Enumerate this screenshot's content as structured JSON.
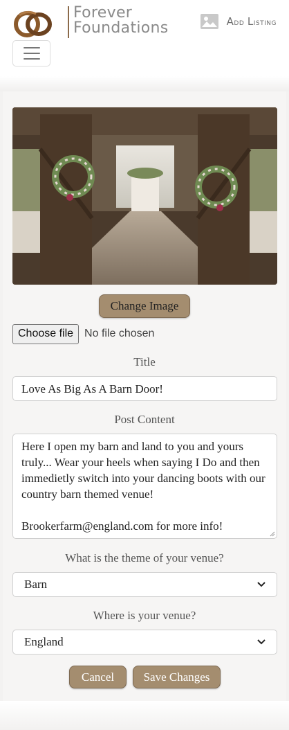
{
  "brand": {
    "line1": "Forever",
    "line2": "Foundations"
  },
  "nav": {
    "add_listing_cap": "A",
    "add_listing_rest": "dd ",
    "add_listing_cap2": "L",
    "add_listing_rest2": "isting",
    "add_listing_icon": "image-icon",
    "menu_icon": "hamburger-menu-icon"
  },
  "form": {
    "change_image_label": "Change Image",
    "file_button_label": "Choose file",
    "file_status": "No file chosen",
    "title_label": "Title",
    "title_value": "Love As Big As A Barn Door!",
    "content_label": "Post Content",
    "content_value": "Here I open my barn and land to you and yours truly... Wear your heels when saying I Do and then immedietly switch into your dancing boots with our country barn themed venue!\n\nBrookerfarm@england.com for more info!",
    "theme_label": "What is the theme of your venue?",
    "theme_value": "Barn",
    "location_label": "Where is your venue?",
    "location_value": "England",
    "cancel_label": "Cancel",
    "save_label": "Save Changes"
  },
  "colors": {
    "accent_brown": "#a48d6f",
    "logo_brown": "#8b6a4a",
    "brand_gray": "#8a8a8a"
  }
}
